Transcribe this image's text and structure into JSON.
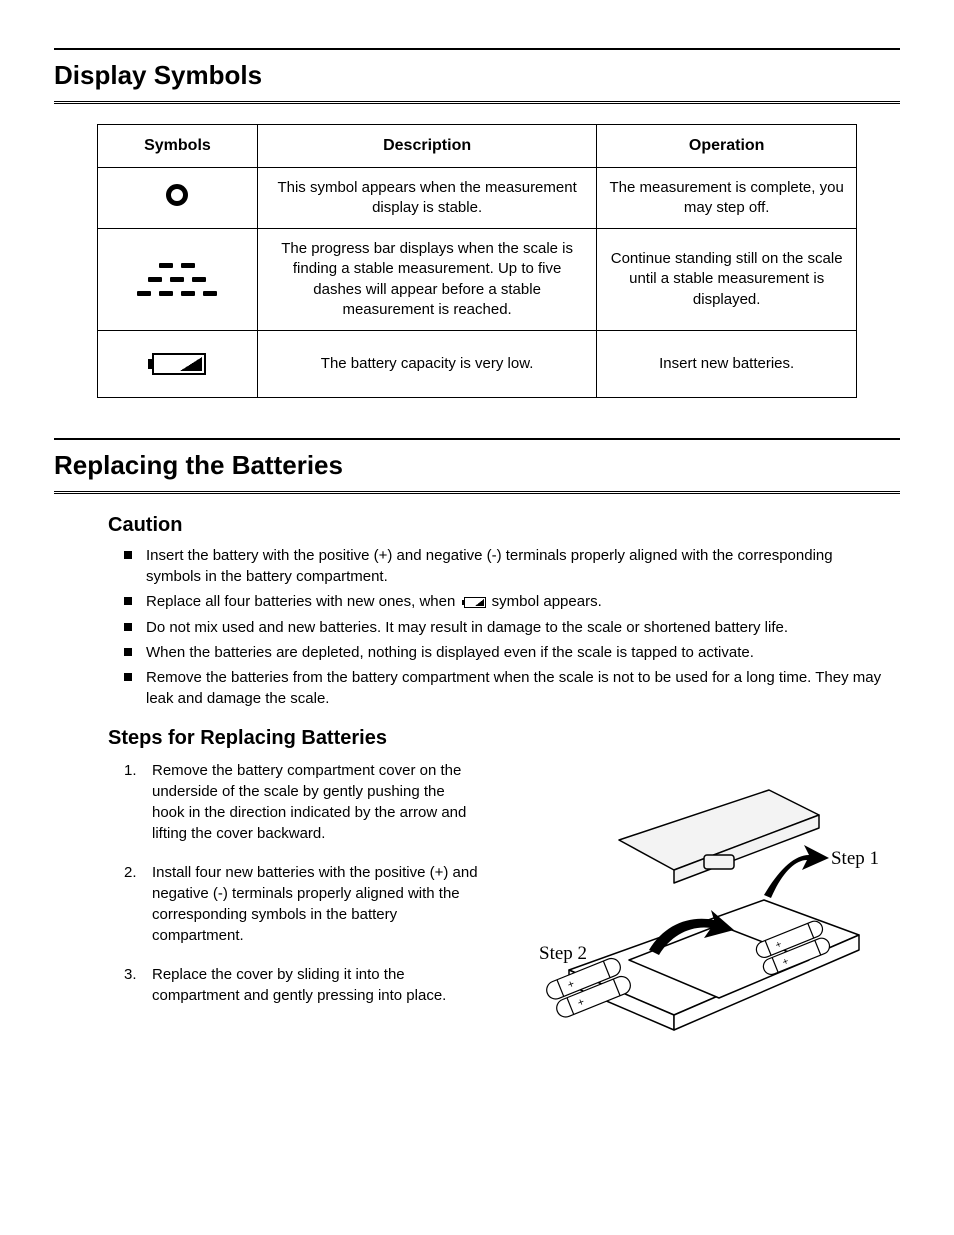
{
  "sections": {
    "display_symbols": {
      "title": "Display Symbols",
      "table": {
        "headers": {
          "symbols": "Symbols",
          "description": "Description",
          "operation": "Operation"
        },
        "rows": [
          {
            "symbol_name": "stable-circle-icon",
            "description": "This symbol appears when the measurement display is stable.",
            "operation": "The measurement is complete, you may step off."
          },
          {
            "symbol_name": "progress-dashes-icon",
            "description": "The progress bar displays when the scale is finding a stable measurement. Up to five dashes will appear before a stable measurement is reached.",
            "operation": "Continue standing still on the scale until a stable measurement is displayed."
          },
          {
            "symbol_name": "low-battery-icon",
            "description": "The battery capacity is very low.",
            "operation": "Insert new batteries."
          }
        ]
      }
    },
    "replacing_batteries": {
      "title": "Replacing the Batteries",
      "caution": {
        "heading": "Caution",
        "items": [
          {
            "text_before": "Insert the battery with the positive (+) and negative (-) terminals properly aligned with the corresponding symbols in the battery compartment.",
            "has_icon": false
          },
          {
            "text_before": "Replace all four batteries with new ones, when ",
            "has_icon": true,
            "text_after": " symbol appears."
          },
          {
            "text_before": "Do not mix used and new batteries. It may result in damage to the scale or shortened battery life.",
            "has_icon": false
          },
          {
            "text_before": "When the batteries are depleted, nothing is displayed even if the scale is tapped to activate.",
            "has_icon": false
          },
          {
            "text_before": "Remove the batteries from the battery compartment when the scale is not to be used for a long time. They may leak and damage the scale.",
            "has_icon": false
          }
        ]
      },
      "steps": {
        "heading": "Steps for Replacing Batteries",
        "items": [
          "Remove the battery compartment cover on the underside of the scale by gently pushing the hook in the direction indicated by the arrow and lifting the cover backward.",
          "Install four new batteries with the positive (+) and negative (-) terminals properly aligned with the corresponding symbols in the battery compartment.",
          "Replace the cover by sliding it into the compartment and gently pressing into place."
        ],
        "figure_labels": {
          "step1": "Step 1",
          "step2": "Step 2"
        }
      }
    }
  }
}
